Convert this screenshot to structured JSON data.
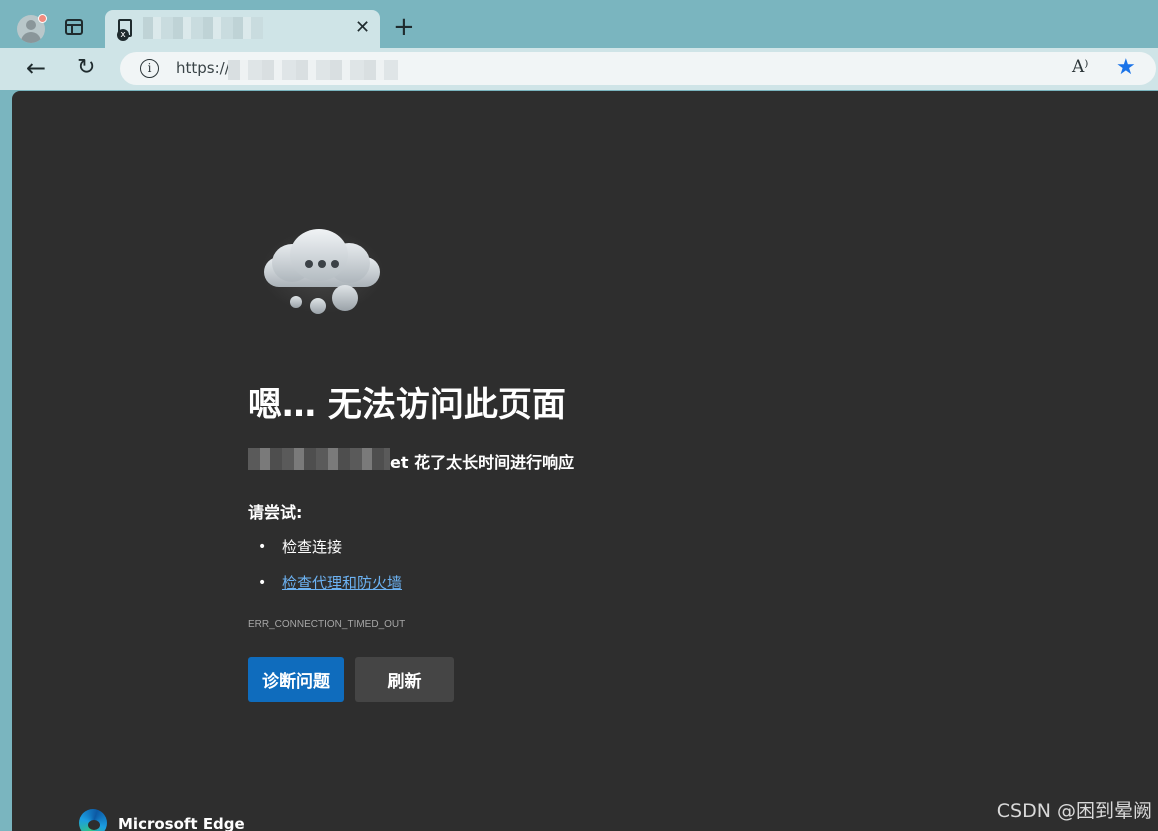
{
  "browser": {
    "tab": {
      "title": "▪▪▪▪▪▪▪▪▪",
      "close_label": "✕",
      "favicon_icon": "page-error-icon"
    },
    "new_tab_label": "+",
    "toolbar": {
      "back_label": "←",
      "reload_label": "↻",
      "info_label": "i",
      "url_prefix": "https://",
      "url_rest": "▪▪▪▪▪▪▪▪▪/",
      "read_aloud_label": "A⁾",
      "favorite_label": "★"
    }
  },
  "error_page": {
    "title": "嗯… 无法访问此页面",
    "host_redacted": "▪▪▪▪▪▪▪▪▪",
    "message_tail": "et 花了太长时间进行响应",
    "try_heading": "请尝试:",
    "suggestions": [
      {
        "text": "检查连接",
        "is_link": false
      },
      {
        "text": "检查代理和防火墙",
        "is_link": true
      }
    ],
    "error_code": "ERR_CONNECTION_TIMED_OUT",
    "buttons": {
      "diagnose": "诊断问题",
      "refresh": "刷新"
    },
    "footer_brand": "Microsoft Edge",
    "colors": {
      "page_bg": "#2e2e2e",
      "primary_button": "#0f6cbd",
      "link": "#6cb2f2",
      "favorite_star": "#1a73e8"
    }
  },
  "watermark": "CSDN @困到晕阙"
}
